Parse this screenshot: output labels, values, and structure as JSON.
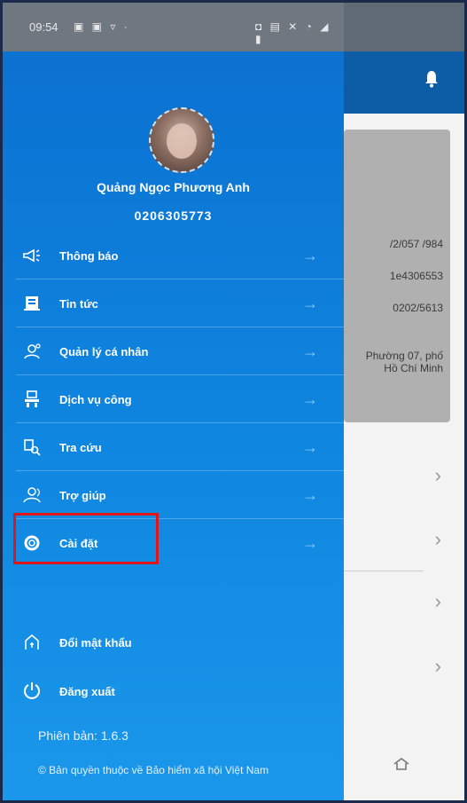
{
  "status_bar": {
    "time": "09:54",
    "left_icons": "▣ ▣ ▿ ·",
    "right_icons": "◘ ▤ ✕ ◔ ◢ ▮"
  },
  "user": {
    "name": "Quảng Ngọc Phương Anh",
    "id": "0206305773"
  },
  "menu": [
    {
      "label": "Thông báo",
      "icon": "megaphone-icon"
    },
    {
      "label": "Tin tức",
      "icon": "news-icon"
    },
    {
      "label": "Quản lý cá nhân",
      "icon": "person-settings-icon"
    },
    {
      "label": "Dịch vụ công",
      "icon": "public-service-icon"
    },
    {
      "label": "Tra cứu",
      "icon": "search-icon"
    },
    {
      "label": "Trợ giúp",
      "icon": "help-icon"
    },
    {
      "label": "Cài đặt",
      "icon": "gear-icon"
    }
  ],
  "bottom": {
    "change_password": "Đổi mật khẩu",
    "logout": "Đăng xuất"
  },
  "version": "Phiên bản: 1.6.3",
  "copyright": "© Bản quyền thuộc về Bảo hiểm xã hội Việt Nam",
  "background": {
    "card_lines": [
      "/2/057 /984",
      "1e4306553",
      "0202/5613",
      "Phường 07, phố Hồ Chí Minh"
    ]
  },
  "colors": {
    "drawer_top": "#0b6fd0",
    "drawer_bottom": "#1a97ea",
    "highlight": "#e0161d"
  }
}
